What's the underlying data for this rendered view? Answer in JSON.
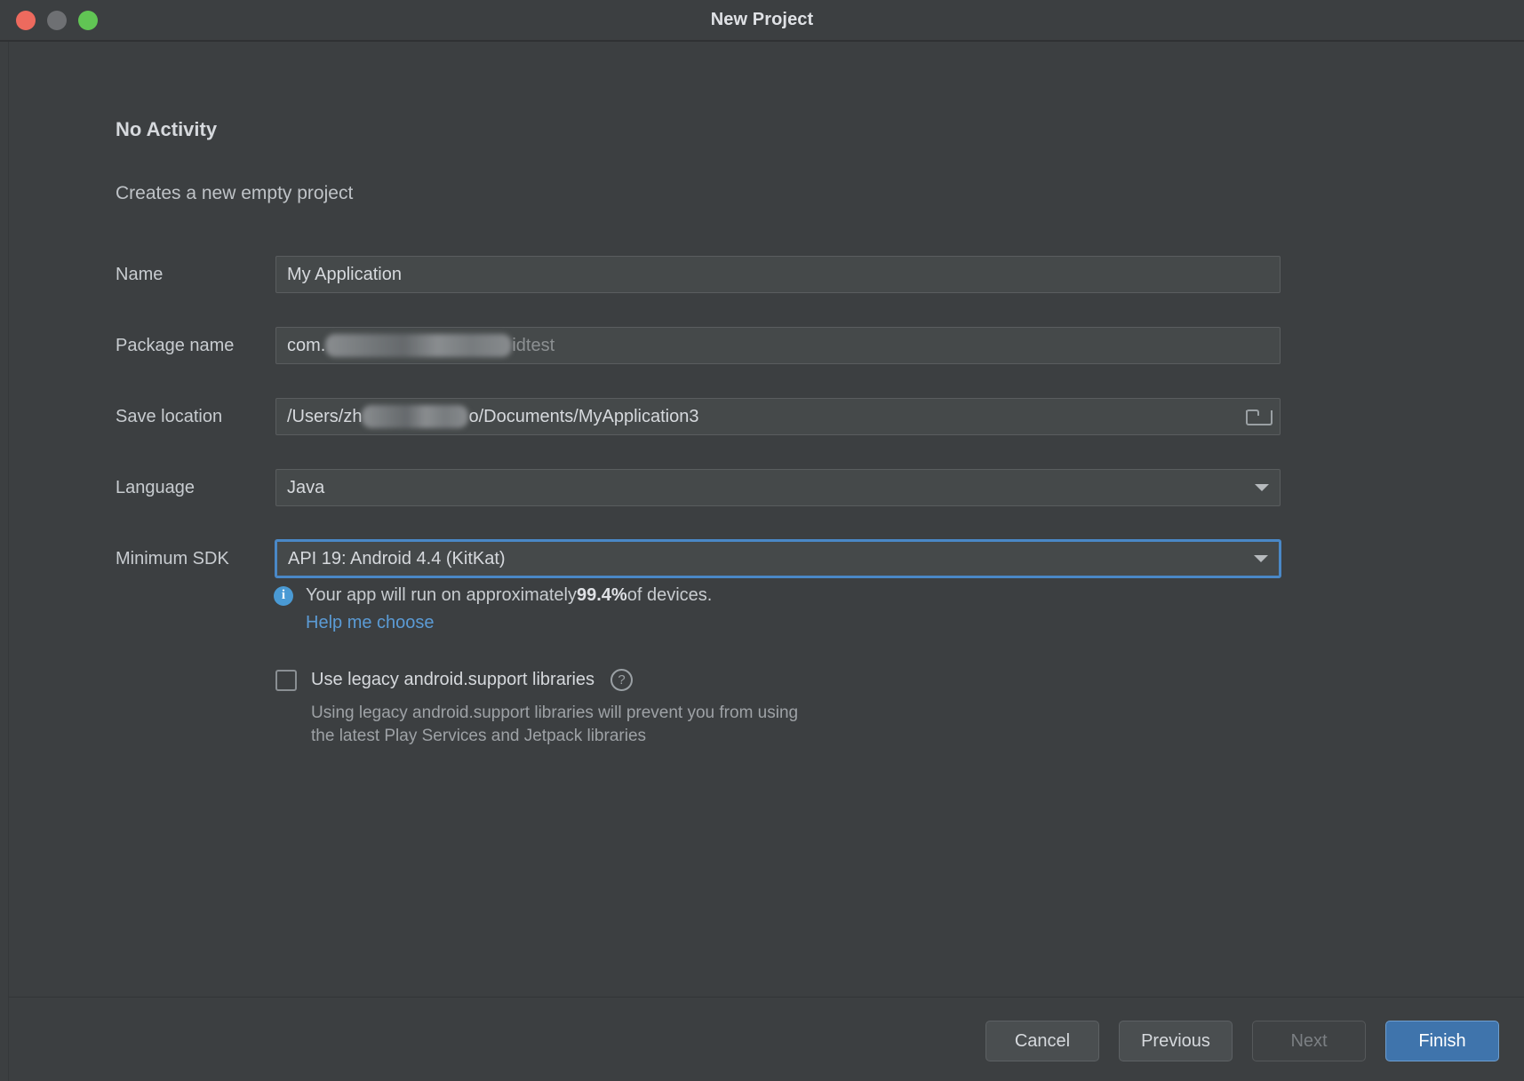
{
  "window": {
    "title": "New Project",
    "traffic_lights": [
      {
        "name": "close",
        "color": "#ed6a5e"
      },
      {
        "name": "minimize",
        "color": "#6e7073"
      },
      {
        "name": "zoom",
        "color": "#61c554"
      }
    ]
  },
  "step": {
    "title": "No Activity",
    "description": "Creates a new empty project"
  },
  "form": {
    "name": {
      "label": "Name",
      "value": "My Application"
    },
    "package_name": {
      "label": "Package name",
      "prefix": "com.",
      "suffix": "idtest",
      "redacted": true
    },
    "save_location": {
      "label": "Save location",
      "prefix": "/Users/zh",
      "suffix": "o/Documents/MyApplication3",
      "redacted": true,
      "browse_icon": "folder-icon"
    },
    "language": {
      "label": "Language",
      "value": "Java",
      "icon": "chevron-down-icon"
    },
    "minimum_sdk": {
      "label": "Minimum SDK",
      "value": "API 19: Android 4.4 (KitKat)",
      "icon": "chevron-down-icon",
      "focused": true
    }
  },
  "info": {
    "icon": "info-icon",
    "text_before": "Your app will run on approximately ",
    "percent": "99.4%",
    "text_after": " of devices.",
    "link": "Help me choose"
  },
  "legacy": {
    "checkbox_label": "Use legacy android.support libraries",
    "checked": false,
    "help_icon": "question-mark-icon",
    "hint_line1": "Using legacy android.support libraries will prevent you from using",
    "hint_line2": "the latest Play Services and Jetpack libraries"
  },
  "footer": {
    "cancel": "Cancel",
    "previous": "Previous",
    "next": "Next",
    "finish": "Finish"
  },
  "colors": {
    "window_bg": "#3c3f41",
    "field_bg": "#45494a",
    "accent": "#4a88c7",
    "link": "#5b9bd5",
    "primary_button": "#3f74ac",
    "info_icon": "#4a9ad4"
  }
}
